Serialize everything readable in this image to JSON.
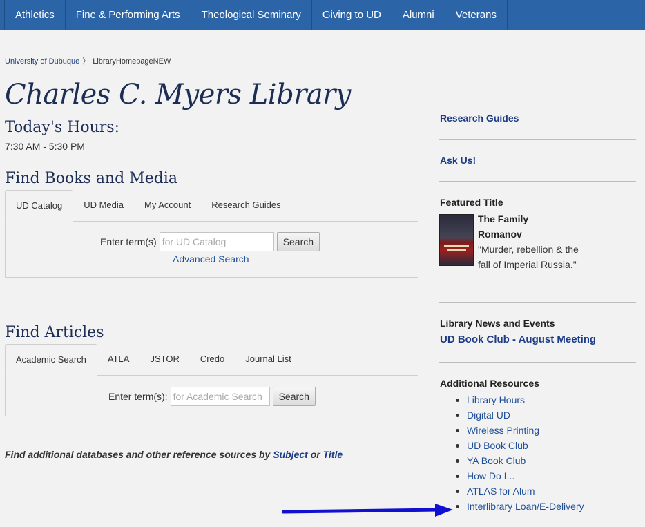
{
  "topnav": {
    "items": [
      "Athletics",
      "Fine & Performing Arts",
      "Theological Seminary",
      "Giving to UD",
      "Alumni",
      "Veterans"
    ]
  },
  "breadcrumb": {
    "home": "University of Dubuque",
    "separator": "〉",
    "current": "LibraryHomepageNEW"
  },
  "main": {
    "title": "Charles C. Myers Library",
    "hours_heading": "Today's Hours:",
    "hours_value": "7:30 AM - 5:30 PM",
    "books": {
      "heading": "Find Books and Media",
      "tabs": [
        "UD Catalog",
        "UD Media",
        "My Account",
        "Research Guides"
      ],
      "active_tab": "UD Catalog",
      "label": "Enter term(s)",
      "placeholder": "for UD Catalog",
      "button": "Search",
      "advanced_link": "Advanced Search"
    },
    "articles": {
      "heading": "Find Articles",
      "tabs": [
        "Academic Search",
        "ATLA",
        "JSTOR",
        "Credo",
        "Journal List"
      ],
      "active_tab": "Academic Search",
      "label": "Enter term(s):",
      "placeholder": "for Academic Search",
      "button": "Search"
    },
    "footnote": {
      "prefix": "Find additional databases and other reference sources by ",
      "subject_link": "Subject",
      "middle": " or ",
      "title_link": "Title"
    }
  },
  "sidebar": {
    "research_guides": "Research Guides",
    "ask_us": "Ask Us!",
    "featured": {
      "heading": "Featured Title",
      "book_title": "The Family Romanov",
      "book_desc": "\"Murder, rebellion & the fall of Imperial Russia.\""
    },
    "news": {
      "heading": "Library News and Events",
      "link": "UD Book Club - August Meeting"
    },
    "resources": {
      "heading": "Additional Resources",
      "items": [
        "Library Hours",
        "Digital UD",
        "Wireless Printing",
        "UD Book Club",
        "YA Book Club",
        "How Do I...",
        "ATLAS for Alum",
        "Interlibrary Loan/E-Delivery"
      ]
    }
  },
  "annotation": {
    "arrow_color": "#1010d0"
  }
}
